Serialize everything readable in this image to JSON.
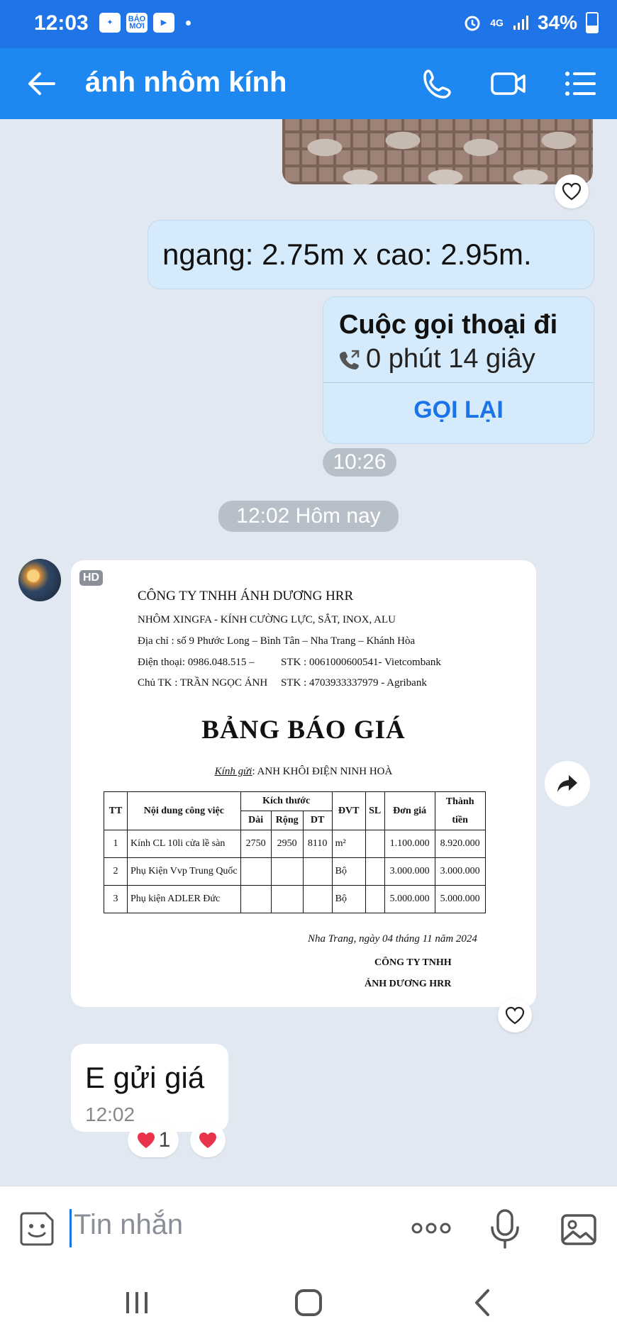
{
  "status_bar": {
    "time": "12:03",
    "app_icon_label": "BÁO MỚI",
    "network": "4G",
    "battery": "34%"
  },
  "header": {
    "title": "ánh nhôm kính",
    "icons": [
      "back-arrow-icon",
      "phone-icon",
      "video-call-icon",
      "menu-list-icon"
    ]
  },
  "messages": {
    "dimensions_text": "ngang: 2.75m x cao: 2.95m.",
    "call": {
      "title": "Cuộc gọi thoại đi",
      "duration": "0 phút 14 giây",
      "callback_label": "GỌI LẠI"
    },
    "time_1026": "10:26",
    "date_separator": "12:02 Hôm nay",
    "image_badge": "HD",
    "incoming_text": "E gửi giá",
    "incoming_time": "12:02",
    "reaction_count": "1"
  },
  "quote_doc": {
    "company": "CÔNG TY TNHH  ÁNH DƯƠNG HRR",
    "line2": "NHÔM XINGFA - KÍNH CƯỜNG LỰC, SẮT, INOX, ALU",
    "address": "Địa chỉ : số 9 Phước Long – Bình Tân – Nha Trang – Khánh Hòa",
    "phone": "Điện thoại: 0986.048.515 –",
    "stk1": "STK : 0061000600541- Vietcombank",
    "owner": "Chủ TK : TRẦN NGỌC ÁNH",
    "stk2": "STK : 4703933337979 - Agribank",
    "title": "BẢNG BÁO GIÁ",
    "to_label": "Kính gửi",
    "to_value": ": ANH KHÔI ĐIỆN NINH HOÀ",
    "table": {
      "headers": {
        "tt": "TT",
        "desc": "Nội dung công việc",
        "size": "Kích thước",
        "dai": "Dài",
        "rong": "Rộng",
        "dt": "DT",
        "dvt": "ĐVT",
        "sl": "SL",
        "price": "Đơn giá",
        "total_1": "Thành",
        "total_2": "tiền"
      },
      "rows": [
        {
          "tt": "1",
          "desc": "Kính CL 10li cửa lề sàn",
          "dai": "2750",
          "rong": "2950",
          "dt": "8110",
          "dvt": "m²",
          "sl": "",
          "price": "1.100.000",
          "total": "8.920.000"
        },
        {
          "tt": "2",
          "desc": "Phụ Kiện Vvp Trung Quốc",
          "dai": "",
          "rong": "",
          "dt": "",
          "dvt": "Bộ",
          "sl": "",
          "price": "3.000.000",
          "total": "3.000.000"
        },
        {
          "tt": "3",
          "desc": "Phụ kiện ADLER Đức",
          "dai": "",
          "rong": "",
          "dt": "",
          "dvt": "Bộ",
          "sl": "",
          "price": "5.000.000",
          "total": "5.000.000"
        }
      ]
    },
    "date_line": "Nha Trang, ngày  04  tháng  11   năm 2024",
    "sign_1": "CÔNG TY TNHH",
    "sign_2": "ÁNH DƯƠNG HRR"
  },
  "input_bar": {
    "placeholder": "Tin nhắn"
  },
  "colors": {
    "header_blue": "#1f88f0",
    "status_blue": "#1f74e8",
    "outgoing_bubble": "#d5ebfb",
    "chat_background": "#e2e8f1",
    "link_blue": "#1a73e8"
  }
}
